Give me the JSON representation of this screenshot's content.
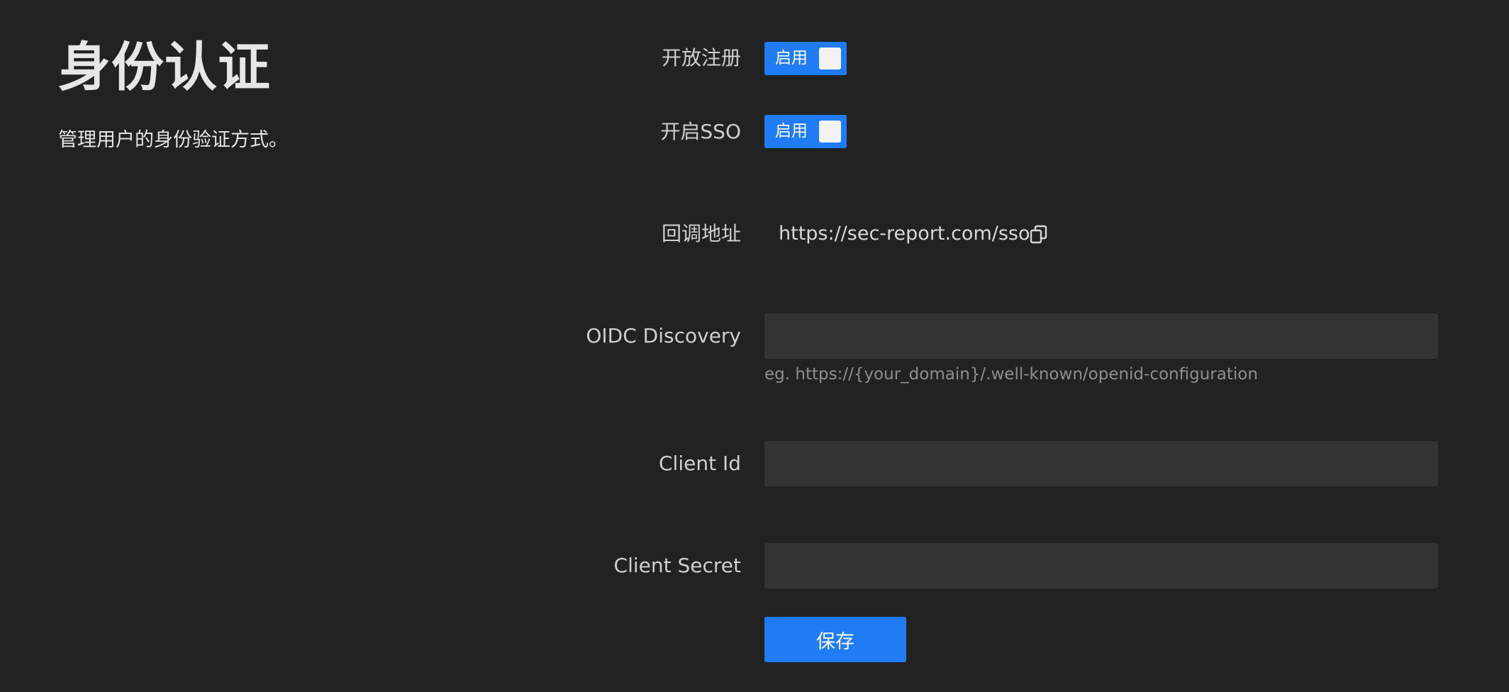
{
  "header": {
    "title": "身份认证",
    "description": "管理用户的身份验证方式。"
  },
  "form": {
    "open_registration": {
      "label": "开放注册",
      "switch_text": "启用",
      "enabled": true
    },
    "enable_sso": {
      "label": "开启SSO",
      "switch_text": "启用",
      "enabled": true
    },
    "callback_url": {
      "label": "回调地址",
      "value": "https://sec-report.com/sso",
      "copy_icon": "copy-icon"
    },
    "oidc_discovery": {
      "label": "OIDC Discovery",
      "value": "",
      "placeholder": "",
      "help": "eg. https://{your_domain}/.well-known/openid-configuration"
    },
    "client_id": {
      "label": "Client Id",
      "value": "",
      "placeholder": ""
    },
    "client_secret": {
      "label": "Client Secret",
      "value": "",
      "placeholder": ""
    },
    "save_label": "保存"
  },
  "colors": {
    "background": "#222222",
    "accent": "#1f7cf4",
    "input_background": "#333333"
  }
}
